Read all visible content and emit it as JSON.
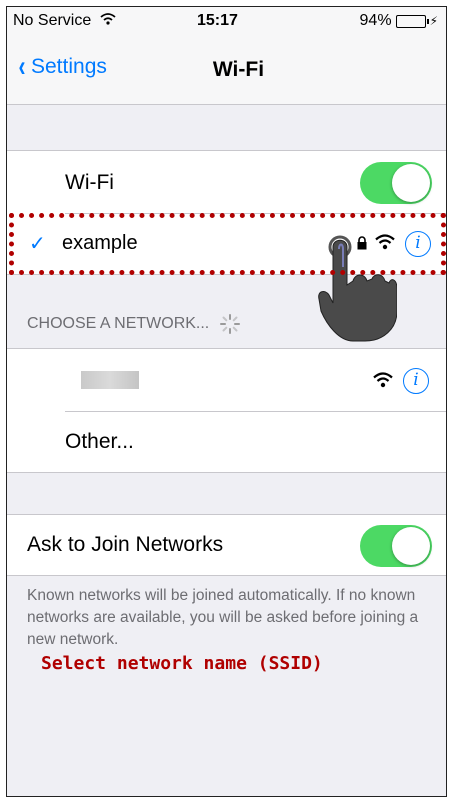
{
  "status_bar": {
    "carrier": "No Service",
    "time": "15:17",
    "battery": "94%"
  },
  "nav": {
    "back_label": "Settings",
    "title": "Wi-Fi"
  },
  "wifi_toggle": {
    "label": "Wi-Fi",
    "on": true
  },
  "connected_network": {
    "checkmark": "✓",
    "name": "example",
    "lock_icon": "lock-icon",
    "signal_icon": "wifi-signal-icon"
  },
  "choose_header": "CHOOSE A NETWORK...",
  "networks": [
    {
      "name": "",
      "blurred": true
    },
    {
      "name": "Other..."
    }
  ],
  "ask_to_join": {
    "label": "Ask to Join Networks",
    "on": true
  },
  "ask_footer": "Known networks will be joined automatically. If no known networks are available, you will be asked before joining a new network.",
  "annotation": "Select network name (SSID)",
  "colors": {
    "accent": "#007aff",
    "toggle_on": "#4cd964",
    "annotation": "#b00000"
  }
}
